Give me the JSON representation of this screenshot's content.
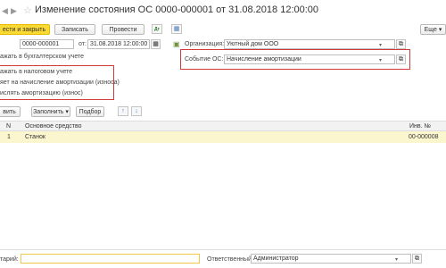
{
  "window": {
    "title": "Изменение состояния ОС 0000-000001 от 31.08.2018 12:00:00",
    "back_icon": "arrow-left-icon",
    "forward_icon": "arrow-right-icon",
    "favorite_icon": "star-icon"
  },
  "toolbar": {
    "post_close_label": "ести и закрыть",
    "save_label": "Записать",
    "post_label": "Провести",
    "more_label": "Еще",
    "more_arrow": "▾"
  },
  "header": {
    "number_value": "0000-000001",
    "date_label": "от:",
    "date_value": "31.08.2018 12:00:00",
    "org_label": "Организация:",
    "org_value": "Уютный дом ООО",
    "event_label": "Событие ОС:",
    "event_value": "Начисление амортизации",
    "reflect_accounting": "ажать в бухгалтерском учете"
  },
  "options": {
    "tax": "ажать в налоговом учете",
    "amort_flag": "яет на начисление амортизации (износа)",
    "calc_amort": "ислять амортизацию (износ)"
  },
  "table_toolbar": {
    "add_label": "вить",
    "fill_label": "Заполнить",
    "fill_arrow": "▾",
    "select_label": "Подбор",
    "up_icon": "arrow-up-icon",
    "down_icon": "arrow-down-icon"
  },
  "table": {
    "columns": [
      "N",
      "Основное средство",
      "Инв. №"
    ],
    "rows": [
      {
        "n": "1",
        "asset": "Станок",
        "inv": "00-000008"
      }
    ]
  },
  "footer": {
    "comment_label": "тарий:",
    "comment_value": "",
    "responsible_label": "Ответственный:",
    "responsible_value": "Администратор"
  }
}
